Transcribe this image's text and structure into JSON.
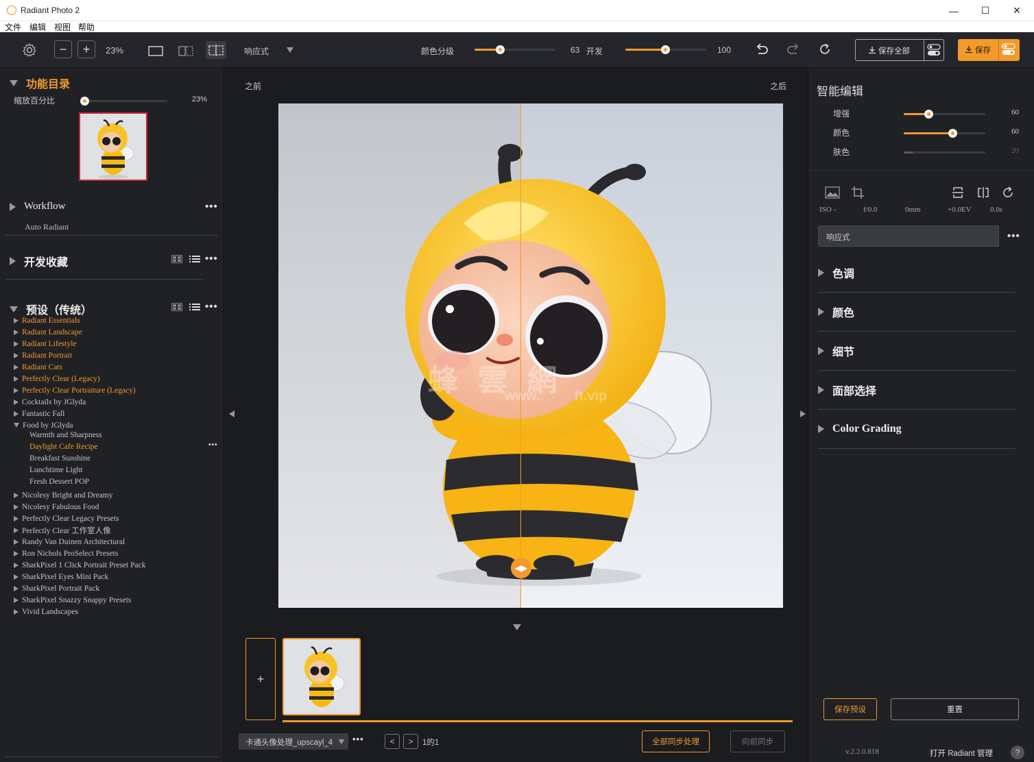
{
  "window": {
    "title": "Radiant Photo 2",
    "minimize_glyph": "—",
    "maximize_glyph": "☐",
    "close_glyph": "✕"
  },
  "menu": [
    "文件",
    "编辑",
    "视图",
    "帮助"
  ],
  "toolbar": {
    "zoom_minus": "−",
    "zoom_plus": "+",
    "zoom_value": "23%",
    "mode_label": "响应式",
    "color_grade_label": "颜色分级",
    "color_grade_value": "63",
    "color_grade_fraction": 0.31,
    "develop_label": "开发",
    "develop_value": "100",
    "develop_fraction": 0.49,
    "save_all_label": "保存全部",
    "save_label": "保存",
    "accent_color": "#f39a2c"
  },
  "left": {
    "catalog_title": "功能目录",
    "zoom_label": "缩放百分比",
    "zoom_value": "23%",
    "zoom_fraction": 0.0,
    "workflow_title": "Workflow",
    "workflow_sub": "Auto Radiant",
    "favorites_title": "开发收藏",
    "presets_title": "预设（传统）",
    "more_glyph": "•••",
    "presets": [
      {
        "label": "Radiant Essentials",
        "highlight": true
      },
      {
        "label": "Radiant Landscape",
        "highlight": true
      },
      {
        "label": "Radiant Lifestyle",
        "highlight": true
      },
      {
        "label": "Radiant Portrait",
        "highlight": true
      },
      {
        "label": "Radiant Cats",
        "highlight": true
      },
      {
        "label": "Perfectly Clear (Legacy)",
        "highlight": true
      },
      {
        "label": "Perfectly Clear Portraiture (Legacy)",
        "highlight": true
      },
      {
        "label": "Cocktails by JGlyda",
        "highlight": false
      },
      {
        "label": "Fantastic Fall",
        "highlight": false
      },
      {
        "label": "Food by JGlyda",
        "highlight": false,
        "expanded": true
      }
    ],
    "food_children": [
      {
        "label": "Warmth and Sharpness",
        "highlight": false
      },
      {
        "label": "Daylight Cafe Recipe",
        "highlight": true
      },
      {
        "label": "Breakfast Sunshine",
        "highlight": false
      },
      {
        "label": "Lunchtime Light",
        "highlight": false
      },
      {
        "label": "Fresh Dessert POP",
        "highlight": false
      }
    ],
    "presets_more": [
      "Nicolesy Bright and Dreamy",
      "Nicolesy Fabulous Food",
      "Perfectly Clear Legacy Presets",
      "Perfectly Clear 工作室人像",
      "Randy Van Duinen Architectural",
      "Ron Nichols ProSelect Presets",
      "SharkPixel 1 Click Portrait Preset Pack",
      "SharkPixel Eyes Mini Pack",
      "SharkPixel Portrait Pack",
      "SharkPixel Snazzy Snappy Presets",
      "Vivid Landscapes"
    ]
  },
  "center": {
    "before_label": "之前",
    "after_label": "之后",
    "watermark": "蜂 雲 網",
    "watermark_sub": "www.         ft.vip",
    "add_glyph": "+",
    "file_name": "卡通头像处理_upscayl_4",
    "page_info": "1的1",
    "sync_all_label": "全部同步处理",
    "sync_forward_label": "向前同步"
  },
  "right": {
    "smart_edit_title": "智能编辑",
    "sliders": [
      {
        "label": "增强",
        "value": "60",
        "fraction": 0.3,
        "enabled": true
      },
      {
        "label": "颜色",
        "value": "60",
        "fraction": 0.6,
        "enabled": true
      },
      {
        "label": "肤色",
        "value": "20",
        "fraction": 0.12,
        "enabled": false
      }
    ],
    "meta": [
      "ISO -",
      "f/0.0",
      "0mm",
      "+0.0EV",
      "0.0s"
    ],
    "preset_select": "响应式",
    "sections": [
      "色调",
      "颜色",
      "细节",
      "面部选择",
      "Color Grading"
    ],
    "save_preset_label": "保存预设",
    "reset_label": "重置",
    "version": "v.2.2.0.818",
    "open_manager": "打开 Radiant 管理",
    "help_glyph": "?"
  }
}
